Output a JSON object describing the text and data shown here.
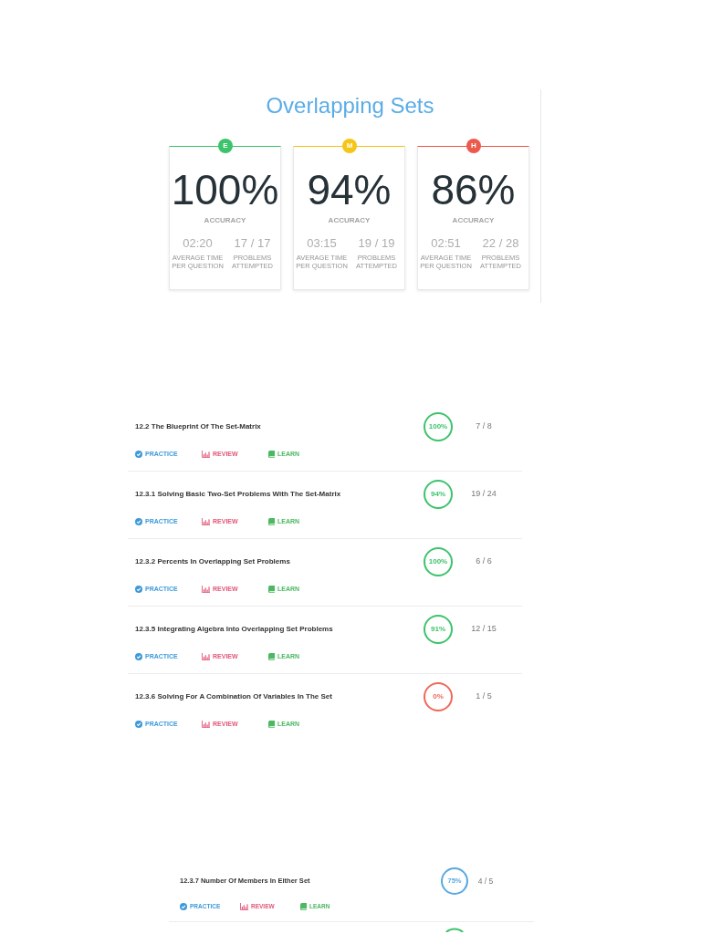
{
  "header": {
    "title": "Overlapping Sets"
  },
  "difficulty_cards": [
    {
      "badge": "E",
      "color": "#3cc36b",
      "accuracy": "100%",
      "accuracy_label": "ACCURACY",
      "avg_time": "02:20",
      "avg_time_label": "AVERAGE TIME PER QUESTION",
      "problems": "17 / 17",
      "problems_label": "PROBLEMS ATTEMPTED"
    },
    {
      "badge": "M",
      "color": "#f5c518",
      "accuracy": "94%",
      "accuracy_label": "ACCURACY",
      "avg_time": "03:15",
      "avg_time_label": "AVERAGE TIME PER QUESTION",
      "problems": "19 / 19",
      "problems_label": "PROBLEMS ATTEMPTED"
    },
    {
      "badge": "H",
      "color": "#ec5a4c",
      "accuracy": "86%",
      "accuracy_label": "ACCURACY",
      "avg_time": "02:51",
      "avg_time_label": "AVERAGE TIME PER QUESTION",
      "problems": "22 / 28",
      "problems_label": "PROBLEMS ATTEMPTED"
    }
  ],
  "lessons": [
    {
      "kind": "full",
      "title": "12.2 The Blueprint Of The Set-Matrix",
      "percent": "100%",
      "color": "#3cc36b",
      "score": "7 / 8",
      "actions": [
        {
          "kind": "practice",
          "label": "PRACTICE"
        },
        {
          "kind": "review",
          "label": "REVIEW"
        },
        {
          "kind": "learn",
          "label": "LEARN"
        }
      ]
    },
    {
      "kind": "full",
      "title": "12.3.1 Solving Basic Two-Set Problems With The Set-Matrix",
      "percent": "94%",
      "color": "#3cc36b",
      "score": "19 / 24",
      "actions": [
        {
          "kind": "practice",
          "label": "PRACTICE"
        },
        {
          "kind": "review",
          "label": "REVIEW"
        },
        {
          "kind": "learn",
          "label": "LEARN"
        }
      ]
    },
    {
      "kind": "full",
      "title": "12.3.2 Percents In Overlapping Set Problems",
      "percent": "100%",
      "color": "#3cc36b",
      "score": "6 / 6",
      "actions": [
        {
          "kind": "practice",
          "label": "PRACTICE"
        },
        {
          "kind": "review",
          "label": "REVIEW"
        },
        {
          "kind": "learn",
          "label": "LEARN"
        }
      ]
    },
    {
      "kind": "full",
      "title": "12.3.5 Integrating Algebra Into Overlapping Set Problems",
      "percent": "91%",
      "color": "#3cc36b",
      "score": "12 / 15",
      "actions": [
        {
          "kind": "practice",
          "label": "PRACTICE"
        },
        {
          "kind": "review",
          "label": "REVIEW"
        },
        {
          "kind": "learn",
          "label": "LEARN"
        }
      ]
    },
    {
      "kind": "full",
      "title": "12.3.6 Solving For A Combination Of Variables In The Set",
      "percent": "0%",
      "color": "#f0685a",
      "score": "1 / 5",
      "actions": [
        {
          "kind": "practice",
          "label": "PRACTICE"
        },
        {
          "kind": "review",
          "label": "REVIEW"
        },
        {
          "kind": "learn",
          "label": "LEARN"
        }
      ]
    }
  ],
  "more_lessons": [
    {
      "kind": "full",
      "title": "12.3.7 Number Of Members In Either Set",
      "percent": "75%",
      "color": "#5aa8e2",
      "score": "4 / 5",
      "actions": [
        {
          "kind": "practice",
          "label": "PRACTICE"
        },
        {
          "kind": "review",
          "label": "REVIEW"
        },
        {
          "kind": "learn",
          "label": "LEARN"
        }
      ]
    },
    {
      "kind": "cut_off",
      "color": "#3cc36b"
    }
  ]
}
